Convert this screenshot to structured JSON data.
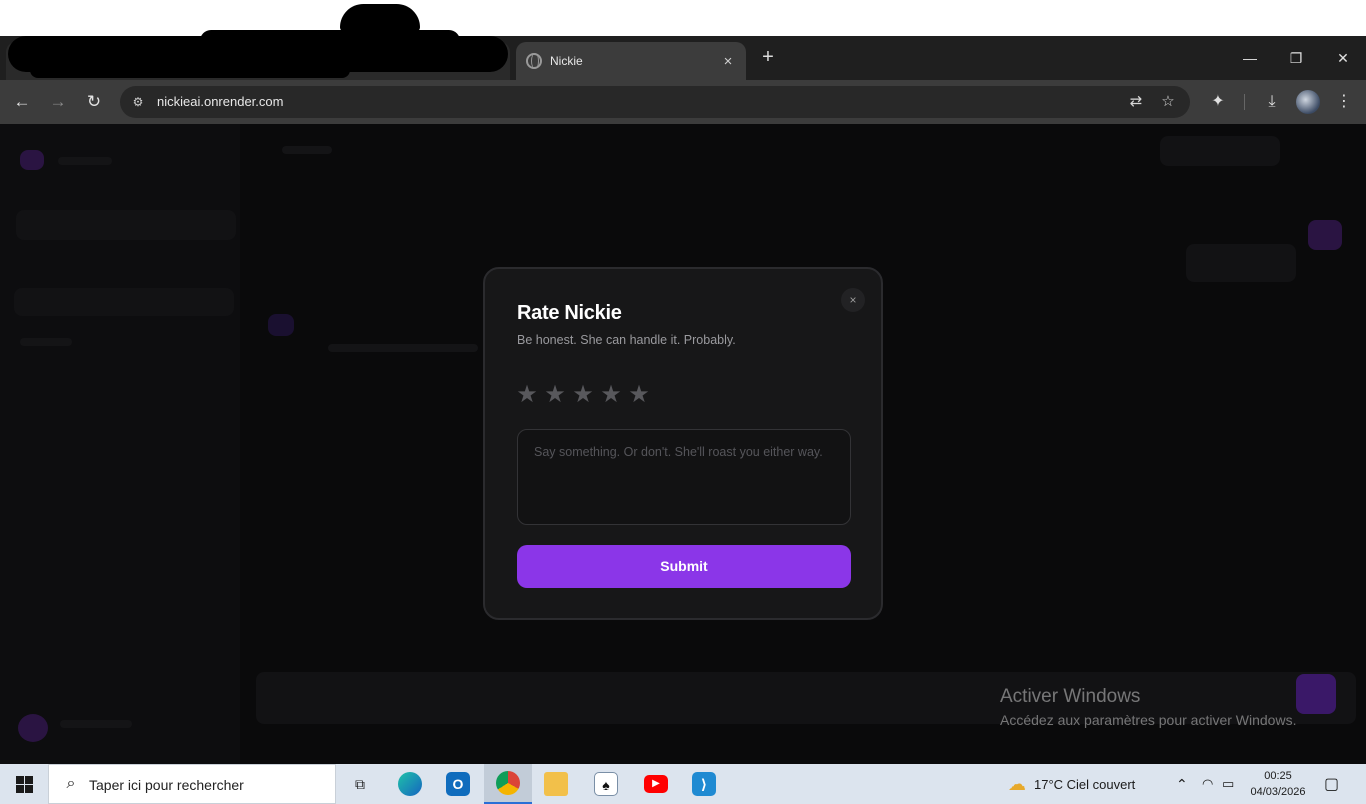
{
  "browser": {
    "tab_title": "Nickie",
    "tab_close": "×",
    "new_tab": "+",
    "url": "nickieai.onrender.com",
    "window_controls": {
      "minimize": "—",
      "restore": "❐",
      "close": "✕"
    }
  },
  "modal": {
    "title": "Rate Nickie",
    "subtitle": "Be honest. She can handle it. Probably.",
    "close": "×",
    "stars": [
      "★",
      "★",
      "★",
      "★",
      "★"
    ],
    "rating": 0,
    "feedback_placeholder": "Say something. Or don't. She'll roast you either way.",
    "submit_label": "Submit",
    "accent": "#8b36e8"
  },
  "watermark": {
    "title": "Activer Windows",
    "subtitle": "Accédez aux paramètres pour activer Windows."
  },
  "taskbar": {
    "search_placeholder": "Taper ici pour rechercher",
    "weather": "17°C  Ciel couvert",
    "time": "00:25",
    "date": "04/03/2026",
    "apps": [
      "task-view",
      "edge",
      "outlook",
      "chrome",
      "file-explorer",
      "solitaire",
      "youtube",
      "vscode"
    ]
  }
}
